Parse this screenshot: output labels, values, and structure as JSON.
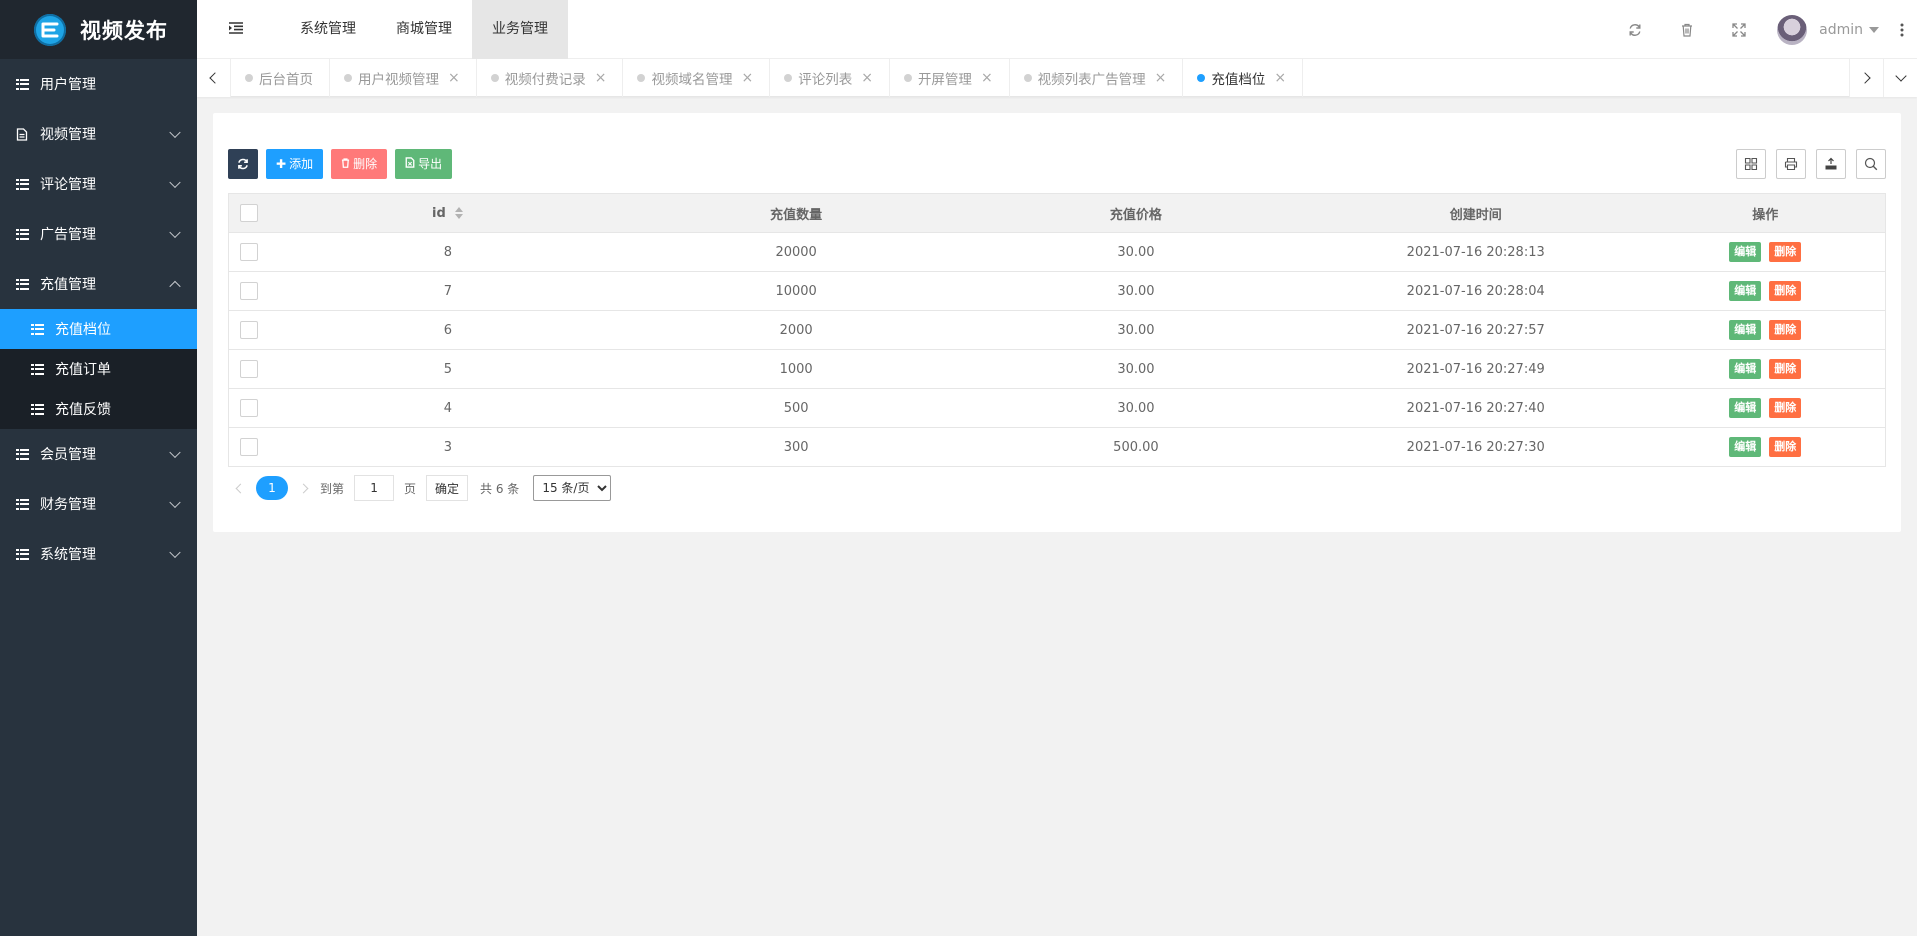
{
  "app": {
    "title": "视频发布"
  },
  "sidebar": {
    "items": [
      {
        "label": "用户管理",
        "icon": "list-icon",
        "expandable": false
      },
      {
        "label": "视频管理",
        "icon": "file-icon",
        "expandable": true
      },
      {
        "label": "评论管理",
        "icon": "list-icon",
        "expandable": true
      },
      {
        "label": "广告管理",
        "icon": "list-icon",
        "expandable": true
      },
      {
        "label": "充值管理",
        "icon": "list-icon",
        "expandable": true,
        "expanded": true
      },
      {
        "label": "会员管理",
        "icon": "list-icon",
        "expandable": true
      },
      {
        "label": "财务管理",
        "icon": "list-icon",
        "expandable": true
      },
      {
        "label": "系统管理",
        "icon": "list-icon",
        "expandable": true
      }
    ],
    "submenu": [
      {
        "label": "充值档位",
        "active": true
      },
      {
        "label": "充值订单",
        "active": false
      },
      {
        "label": "充值反馈",
        "active": false
      }
    ]
  },
  "header": {
    "nav": [
      {
        "label": "系统管理",
        "active": false
      },
      {
        "label": "商城管理",
        "active": false
      },
      {
        "label": "业务管理",
        "active": true
      }
    ],
    "username": "admin"
  },
  "tabs": [
    {
      "label": "后台首页",
      "closable": false,
      "active": false
    },
    {
      "label": "用户视频管理",
      "closable": true,
      "active": false
    },
    {
      "label": "视频付费记录",
      "closable": true,
      "active": false
    },
    {
      "label": "视频域名管理",
      "closable": true,
      "active": false
    },
    {
      "label": "评论列表",
      "closable": true,
      "active": false
    },
    {
      "label": "开屏管理",
      "closable": true,
      "active": false
    },
    {
      "label": "视频列表广告管理",
      "closable": true,
      "active": false
    },
    {
      "label": "充值档位",
      "closable": true,
      "active": true
    }
  ],
  "toolbar": {
    "add": "添加",
    "delete": "删除",
    "export": "导出"
  },
  "table": {
    "columns": [
      "id",
      "充值数量",
      "充值价格",
      "创建时间",
      "操作"
    ],
    "rows": [
      {
        "id": "8",
        "amount": "20000",
        "price": "30.00",
        "created": "2021-07-16 20:28:13"
      },
      {
        "id": "7",
        "amount": "10000",
        "price": "30.00",
        "created": "2021-07-16 20:28:04"
      },
      {
        "id": "6",
        "amount": "2000",
        "price": "30.00",
        "created": "2021-07-16 20:27:57"
      },
      {
        "id": "5",
        "amount": "1000",
        "price": "30.00",
        "created": "2021-07-16 20:27:49"
      },
      {
        "id": "4",
        "amount": "500",
        "price": "30.00",
        "created": "2021-07-16 20:27:40"
      },
      {
        "id": "3",
        "amount": "300",
        "price": "500.00",
        "created": "2021-07-16 20:27:30"
      }
    ],
    "edit_label": "编辑",
    "delete_label": "删除"
  },
  "pagination": {
    "current_page": "1",
    "goto_label": "到第",
    "page_input": "1",
    "page_unit": "页",
    "confirm": "确定",
    "total": "共 6 条",
    "page_size": "15 条/页"
  },
  "colors": {
    "sidebar_bg": "#28333e",
    "accent": "#1e9fff",
    "edit": "#5fb878",
    "delete": "#ff5722"
  }
}
